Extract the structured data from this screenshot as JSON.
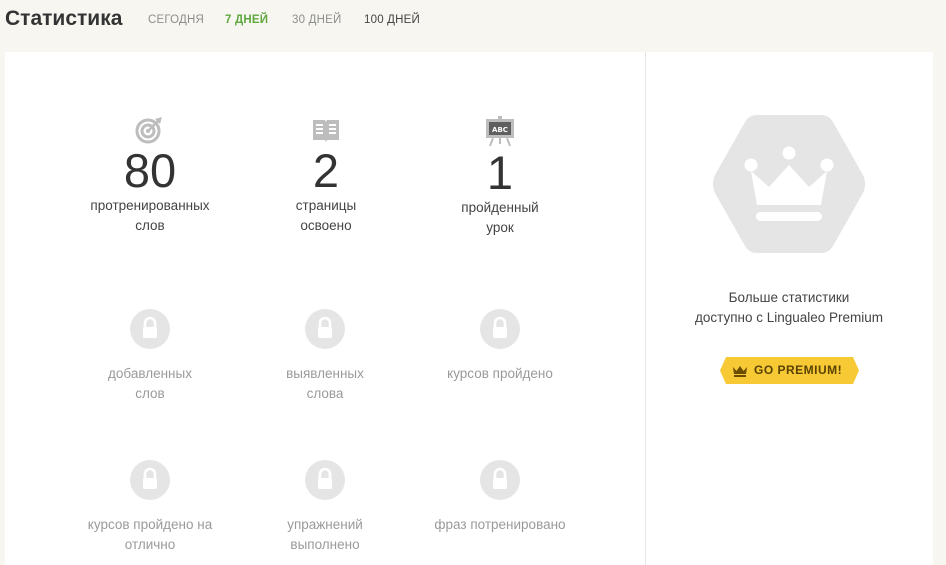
{
  "header": {
    "title": "Статистика",
    "tabs": [
      {
        "label": "СЕГОДНЯ"
      },
      {
        "label": "7 ДНЕЙ"
      },
      {
        "label": "30 ДНЕЙ"
      },
      {
        "label": "100 ДНЕЙ"
      }
    ],
    "active_tab": "7 ДНЕЙ"
  },
  "stats": [
    {
      "icon": "target-icon",
      "value": "80",
      "label_line1": "протренированных",
      "label_line2": "слов"
    },
    {
      "icon": "book-icon",
      "value": "2",
      "label_line1": "страницы",
      "label_line2": "освоено"
    },
    {
      "icon": "chalkboard-icon",
      "value": "1",
      "label_line1": "пройденный",
      "label_line2": "урок"
    }
  ],
  "locked_stats": [
    {
      "label_line1": "добавленных",
      "label_line2": "слов"
    },
    {
      "label_line1": "выявленных",
      "label_line2": "слова"
    },
    {
      "label_line1": "курсов пройдено",
      "label_line2": ""
    },
    {
      "label_line1": "курсов пройдено на",
      "label_line2": "отлично"
    },
    {
      "label_line1": "упражнений",
      "label_line2": "выполнено"
    },
    {
      "label_line1": "фраз потренировано",
      "label_line2": ""
    }
  ],
  "premium": {
    "text_line1": "Больше статистики",
    "text_line2": "доступно с Lingualeo Premium",
    "button_label": "GO PREMIUM!",
    "icon": "crown-icon"
  },
  "colors": {
    "accent_green": "#5fa83e",
    "premium_yellow": "#f7c935",
    "background": "#f7f6f1"
  },
  "abc_label": "ABC"
}
